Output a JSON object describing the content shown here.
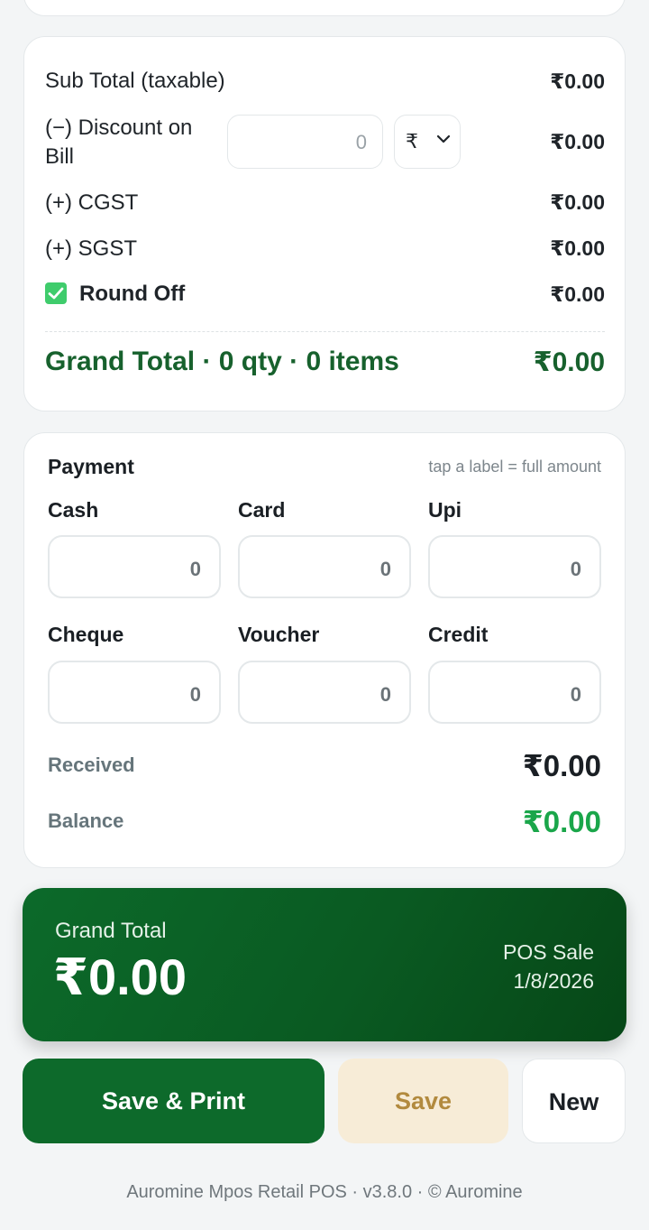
{
  "summary": {
    "subtotal_label": "Sub Total (taxable)",
    "subtotal_value": "₹0.00",
    "discount_label_1": "(−) Discount on",
    "discount_label_2": "Bill",
    "discount_input_value": "0",
    "discount_type": "₹",
    "discount_value": "₹0.00",
    "cgst_label": "(+) CGST",
    "cgst_value": "₹0.00",
    "sgst_label": "(+) SGST",
    "sgst_value": "₹0.00",
    "roundoff_label": "Round Off",
    "roundoff_checked": true,
    "roundoff_value": "₹0.00",
    "grand_label": "Grand Total · 0 qty · 0 items",
    "grand_value": "₹0.00"
  },
  "payment": {
    "title": "Payment",
    "hint": "tap a label = full amount",
    "methods": [
      {
        "label": "Cash",
        "value": "0"
      },
      {
        "label": "Card",
        "value": "0"
      },
      {
        "label": "Upi",
        "value": "0"
      },
      {
        "label": "Cheque",
        "value": "0"
      },
      {
        "label": "Voucher",
        "value": "0"
      },
      {
        "label": "Credit",
        "value": "0"
      }
    ],
    "received_label": "Received",
    "received_value": "₹0.00",
    "balance_label": "Balance",
    "balance_value": "₹0.00"
  },
  "banner": {
    "label": "Grand Total",
    "value": "₹0.00",
    "sale_type": "POS Sale",
    "date": "1/8/2026"
  },
  "actions": {
    "save_print": "Save & Print",
    "save": "Save",
    "new": "New"
  },
  "footer": "Auromine Mpos Retail POS · v3.8.0 · © Auromine",
  "colors": {
    "brand_green": "#0d6a2b",
    "grand_total_text": "#17612d",
    "balance_green": "#1aa64a",
    "checkbox_green": "#3fcc6c",
    "save_bg": "#f7ecd7"
  }
}
